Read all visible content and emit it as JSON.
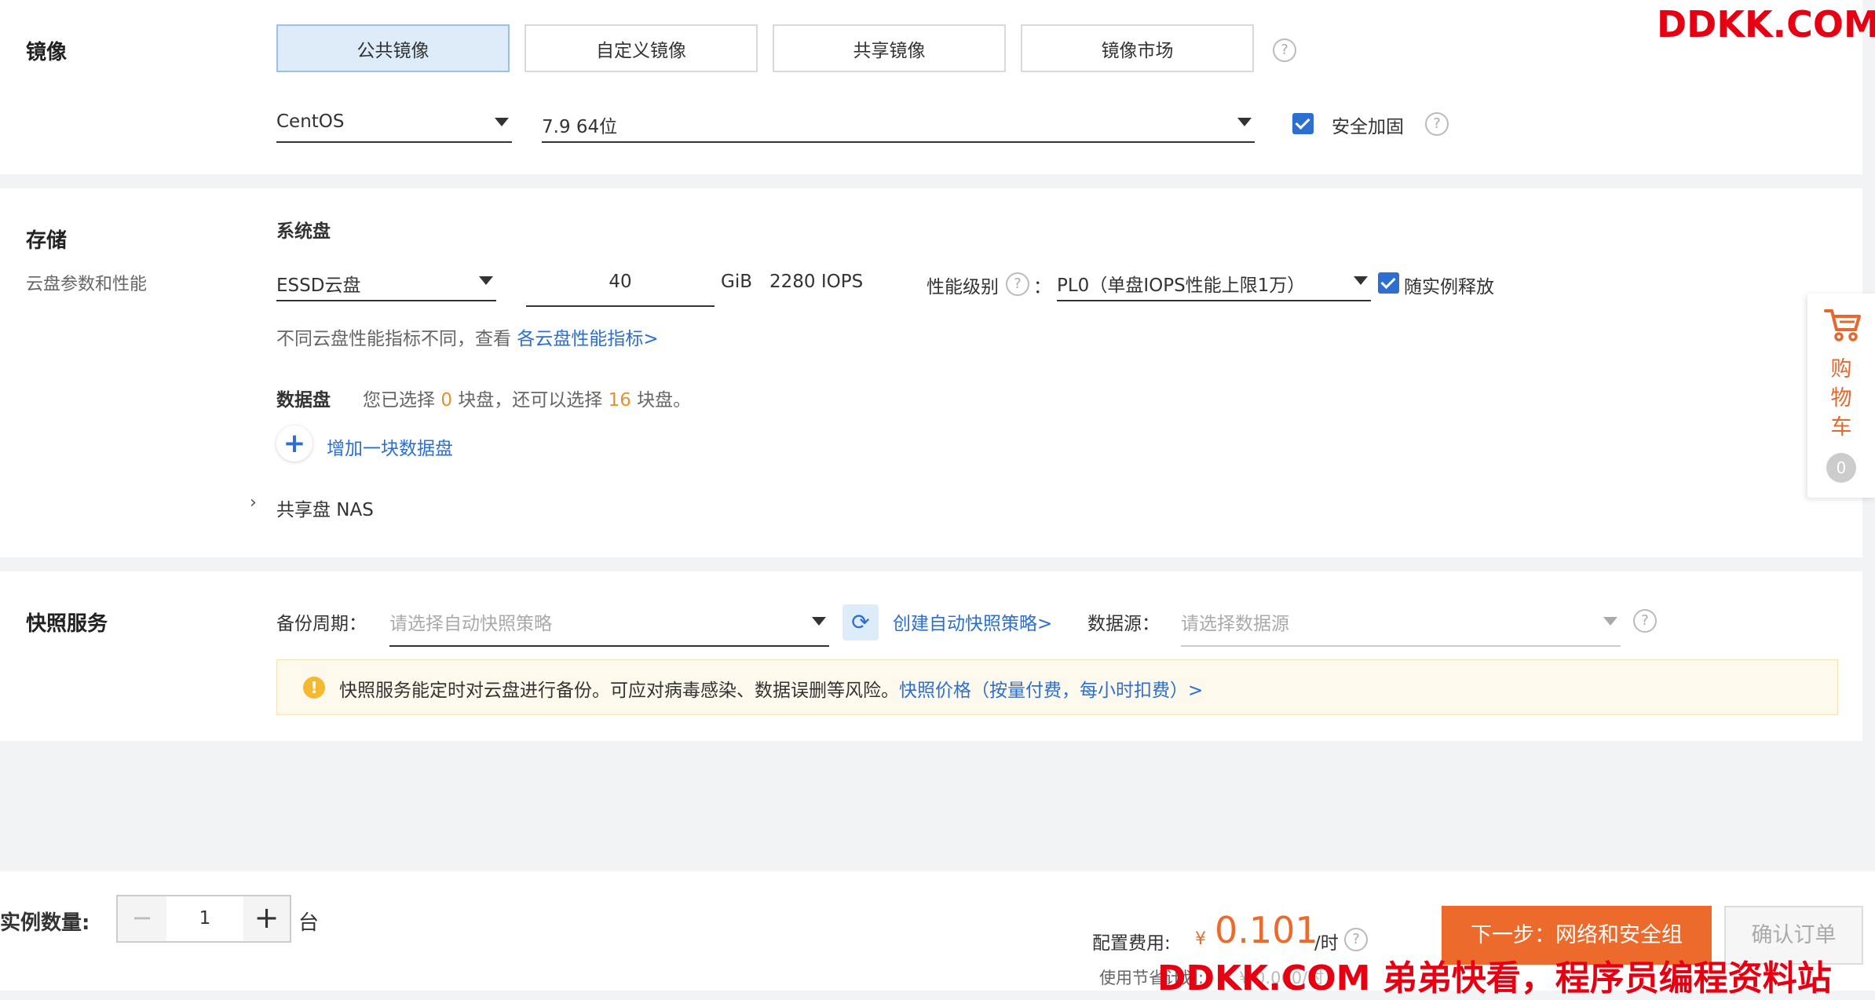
{
  "image_section": {
    "title": "镜像",
    "tabs": [
      {
        "label": "公共镜像",
        "active": true
      },
      {
        "label": "自定义镜像",
        "active": false
      },
      {
        "label": "共享镜像",
        "active": false
      },
      {
        "label": "镜像市场",
        "active": false
      }
    ],
    "os_select": "CentOS",
    "version_select": "7.9 64位",
    "security_label": "安全加固",
    "security_checked": true
  },
  "storage_section": {
    "title": "存储",
    "subtitle": "云盘参数和性能",
    "system_disk_label": "系统盘",
    "disk_type": "ESSD云盘",
    "disk_size": "40",
    "size_unit": "GiB",
    "iops": "2280 IOPS",
    "perf_label": "性能级别",
    "perf_colon": "：",
    "perf_value": "PL0（单盘IOPS性能上限1万）",
    "release_label": "随实例释放",
    "hint_text": "不同云盘性能指标不同，查看",
    "hint_link": "各云盘性能指标>",
    "data_disk_label": "数据盘",
    "data_disk_info_1": "您已选择",
    "data_disk_selected": "0",
    "data_disk_info_2": "块盘，还可以选择",
    "data_disk_remaining": "16",
    "data_disk_info_3": "块盘。",
    "add_disk_label": "增加一块数据盘",
    "shared_nas_label": "共享盘 NAS"
  },
  "snapshot_section": {
    "title": "快照服务",
    "backup_label": "备份周期：",
    "backup_placeholder": "请选择自动快照策略",
    "create_link": "创建自动快照策略>",
    "datasource_label": "数据源：",
    "datasource_placeholder": "请选择数据源",
    "notice_text": "快照服务能定时对云盘进行备份。可应对病毒感染、数据误删等风险。",
    "notice_link": "快照价格（按量付费，每小时扣费）>"
  },
  "cart": {
    "label_chars": [
      "购",
      "物",
      "车"
    ],
    "count": "0"
  },
  "bottom_bar": {
    "quantity_label": "实例数量:",
    "quantity": "1",
    "quantity_unit": "台",
    "fee_label": "配置费用:",
    "currency": "¥",
    "fee_value": "0.101",
    "fee_unit": "/时",
    "savings_label": "使用节省计划:",
    "savings_value": "¥ 0.060/时",
    "next_button": "下一步：网络和安全组",
    "confirm_button": "确认订单"
  },
  "watermark": {
    "top": "DDKK.COM",
    "bottom": "DDKK.COM 弟弟快看，程序员编程资料站"
  },
  "colors": {
    "accent": "#2c6fd1",
    "orange": "#ec6a2b",
    "highlight": "#e8912c",
    "watermark": "#e60012"
  }
}
